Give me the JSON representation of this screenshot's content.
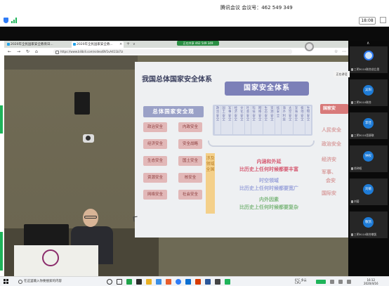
{
  "meeting": {
    "title": "腾讯会议 会议号：462 549 349",
    "timer": "18:08"
  },
  "browser": {
    "tabs": [
      {
        "label": "2020年全民国家安全教育日..."
      },
      {
        "label": "2020年全民国家安全教..."
      }
    ],
    "tab_close": "×",
    "new_tab": "+",
    "tab_menu": "∨",
    "sharing_label": "正在共享 462 549 349",
    "url": "https://www.bilibili.com/video/BV1vA411b7iz",
    "nav": {
      "back": "←",
      "forward": "→",
      "refresh": "↻",
      "home": "⌂"
    },
    "right_icons": [
      "☆",
      "↻",
      "⋯"
    ]
  },
  "slide": {
    "title": "我国总体国家安全体系",
    "system_title": "国家安全体系",
    "left_heading": "总体国家安全观",
    "left_boxes": [
      "政治安全",
      "内政安全",
      "经济安全",
      "安全战略",
      "生态安全",
      "国土安全",
      "资源安全",
      "核安全",
      "网络安全",
      "社会安全"
    ],
    "pillars": [
      "政治安全",
      "国土安全",
      "军事安全",
      "经济安全",
      "文化安全",
      "社会安全",
      "科技安全",
      "网络安全",
      "生态安全",
      "资源安全",
      "核安全",
      "海外利益",
      "太空安全",
      "深海安全",
      "极地安全",
      "生物安全"
    ],
    "vertical_label": "涉及领域全国",
    "center_lines": [
      {
        "text": "内涵和外延",
        "color": "red"
      },
      {
        "text": "比历史上任何时候都要丰富",
        "color": "red"
      },
      {
        "text": "时空领域",
        "color": "purple"
      },
      {
        "text": "比历史上任何时候都要宽广",
        "color": "purple"
      },
      {
        "text": "内外因素",
        "color": "green"
      },
      {
        "text": "比历史上任何时候都要复杂",
        "color": "green"
      }
    ],
    "right_heading": "国家安",
    "right_items": [
      "人民安全",
      "政治安全",
      "经济安",
      "军事、",
      "会安",
      "国际安"
    ]
  },
  "participants": {
    "collapse_icon": "∧",
    "speaking_tag": "正在讲话",
    "list": [
      {
        "avatar": "",
        "name": "三明9110联合创立思"
      },
      {
        "avatar": "吴阳",
        "name": "三明9110联合"
      },
      {
        "avatar": "李佳",
        "name": "三明9110思源联"
      },
      {
        "avatar": "钟权",
        "name": "徐钟权"
      },
      {
        "avatar": "刘菊",
        "name": "刘菊"
      },
      {
        "avatar": "敬凯",
        "name": "三明9110联合敬凯"
      }
    ]
  },
  "taskbar": {
    "search_placeholder": "在这里输入你要搜索的内容",
    "weather": "6°C 多云",
    "cpu": "CPU",
    "time": "16:12",
    "date": "2020/4/16"
  },
  "colors": {
    "accent_green": "#1fb45a",
    "meeting_blue": "#2f7cf6"
  }
}
